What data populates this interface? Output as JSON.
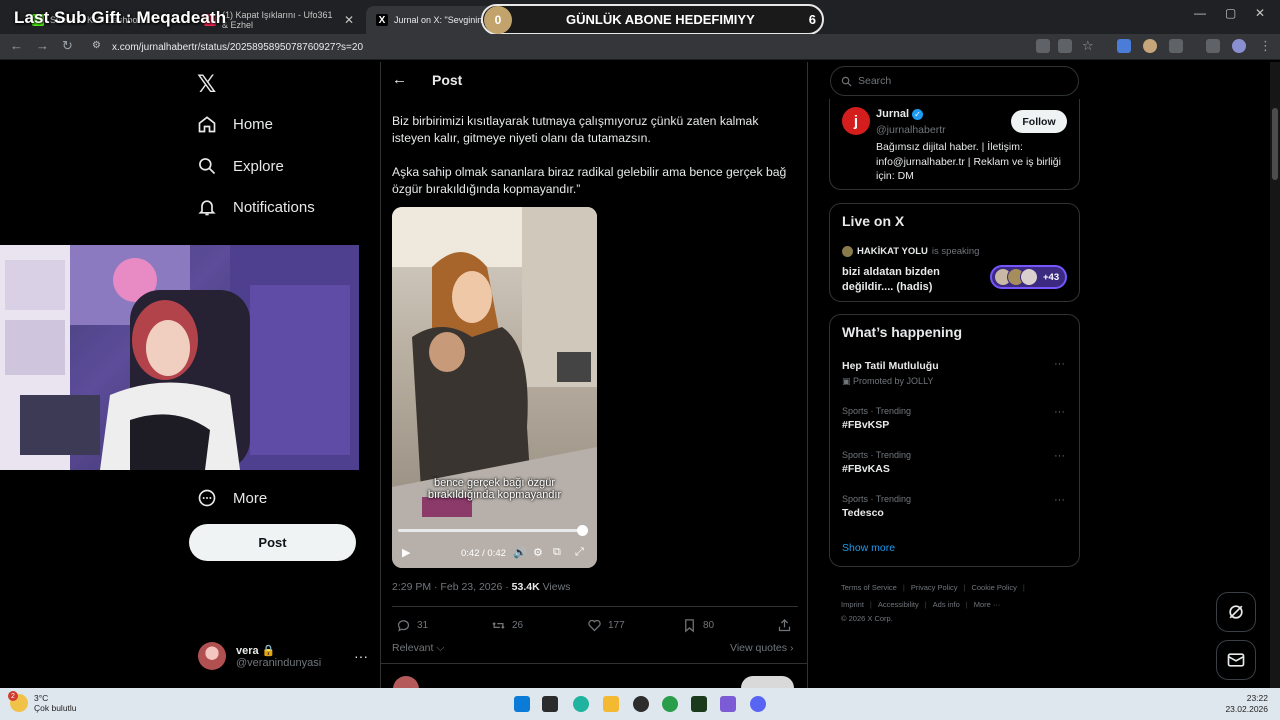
{
  "browser": {
    "tabs": [
      {
        "label": "Stream - Kick Dashboard"
      },
      {
        "label": "(1) Kapat Işıklarını - Ufo361 & Ezhel"
      },
      {
        "label": "Jurnal on X: \"Sevginin kon"
      }
    ],
    "url": "x.com/jurnalhabertr/status/2025895895078760927?s=20"
  },
  "overlay": {
    "last_sub": "Last Sub Gift : Meqadeath",
    "goal_count": "0",
    "goal_label": "GÜNLÜK ABONE HEDEFIMIYY",
    "goal_target": "6"
  },
  "sidebar": {
    "items": [
      {
        "label": "Home",
        "icon": "home-icon"
      },
      {
        "label": "Explore",
        "icon": "search-icon"
      },
      {
        "label": "Notifications",
        "icon": "bell-icon"
      },
      {
        "label": "More",
        "icon": "more-circle-icon"
      }
    ],
    "post_button": "Post",
    "account": {
      "name": "vera",
      "handle": "@veranindunyasi"
    }
  },
  "post": {
    "header": "Post",
    "paragraph1": "Biz birbirimizi kısıtlayarak tutmaya çalışmıyoruz çünkü zaten kalmak isteyen kalır, gitmeye niyeti olanı da tutamazsın.",
    "paragraph2": "Aşka sahip olmak sananlara biraz radikal gelebilir ama bence gerçek bağ özgür bırakıldığında kopmayandır.”",
    "video": {
      "caption_line1": "bence gerçek bağı özgür",
      "caption_line2": "bırakıldığında kopmayandır",
      "time": "0:42 / 0:42",
      "progress": 1.0
    },
    "timestamp": "2:29 PM · Feb 23, 2026 · ",
    "views_count": "53.4K",
    "views_label": " Views",
    "actions": {
      "replies": "31",
      "reposts": "26",
      "likes": "177",
      "bookmarks": "80"
    },
    "sort": "Relevant",
    "view_quotes": "View quotes"
  },
  "right": {
    "search_placeholder": "Search",
    "profile": {
      "name": "Jurnal",
      "handle": "@jurnalhabertr",
      "follow": "Follow",
      "bio": "Bağımsız dijital haber. | İletişim: info@jurnalhaber.tr | Reklam ve iş birliği için: DM"
    },
    "live": {
      "title": "Live on X",
      "host": "HAKİKAT YOLU",
      "status": "is speaking",
      "space_title": "bizi aldatan bizden değildir.... (hadis)",
      "listeners": "+43"
    },
    "happening": {
      "title": "What’s happening",
      "trends": [
        {
          "context": "",
          "name": "Hep Tatil Mutluluğu",
          "promo": "Promoted by JOLLY"
        },
        {
          "context": "Sports · Trending",
          "name": "#FBvKSP",
          "promo": ""
        },
        {
          "context": "Sports · Trending",
          "name": "#FBvKAS",
          "promo": ""
        },
        {
          "context": "Sports · Trending",
          "name": "Tedesco",
          "promo": ""
        }
      ],
      "show_more": "Show more"
    },
    "footer": {
      "links1": [
        "Terms of Service",
        "Privacy Policy",
        "Cookie Policy"
      ],
      "links2": [
        "Imprint",
        "Accessibility",
        "Ads info",
        "More ···"
      ],
      "copyright": "© 2026 X Corp."
    }
  },
  "taskbar": {
    "temp": "3°C",
    "condition": "Çok bulutlu",
    "badge": "2",
    "time": "23:22",
    "date": "23.02.2026"
  },
  "colors": {
    "accent": "#1d9bf0",
    "background": "#000000",
    "border": "#2f3336",
    "muted": "#71767b"
  }
}
